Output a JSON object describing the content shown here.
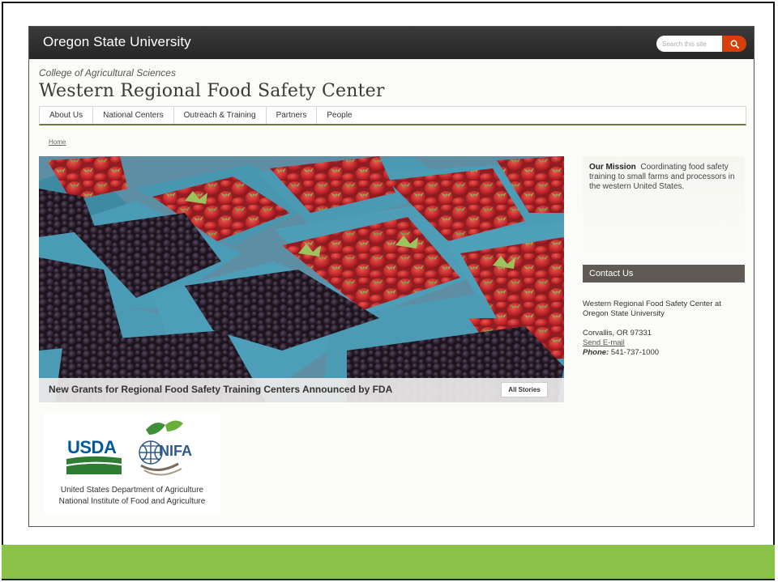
{
  "site": {
    "university": "Oregon State University",
    "college": "College of Agricultural Sciences",
    "title": "Western Regional Food Safety Center"
  },
  "search": {
    "placeholder": "Search this site",
    "icon": "search-icon"
  },
  "nav": {
    "items": [
      "About Us",
      "National Centers",
      "Outreach & Training",
      "Partners",
      "People"
    ]
  },
  "breadcrumb": "Home",
  "hero": {
    "caption": "New Grants for Regional Food Safety Training Centers Announced by FDA",
    "button": "All Stories"
  },
  "mission": {
    "label": "Our Mission",
    "text": "Coordinating food safety training to small farms and processors in the western United States."
  },
  "contact": {
    "heading": "Contact Us",
    "org": "Western Regional Food Safety Center at Oregon State University",
    "city": "Corvallis, OR 97331",
    "email_link": "Send E-mail",
    "phone_label": "Phone:",
    "phone": "541-737-1000"
  },
  "logos": {
    "usda": "USDA",
    "nifa": "NIFA",
    "caption_line1": "United States Department of Agriculture",
    "caption_line2": "National Institute of Food and Agriculture"
  },
  "colors": {
    "topbar": "#2f2f2f",
    "search_button": "#d73f09",
    "nav_underline": "#6e7a3a",
    "contact_header": "#5f5a53",
    "slide_band": "#8bc34a",
    "usda_blue": "#005a9c",
    "usda_green": "#2e7d32"
  }
}
